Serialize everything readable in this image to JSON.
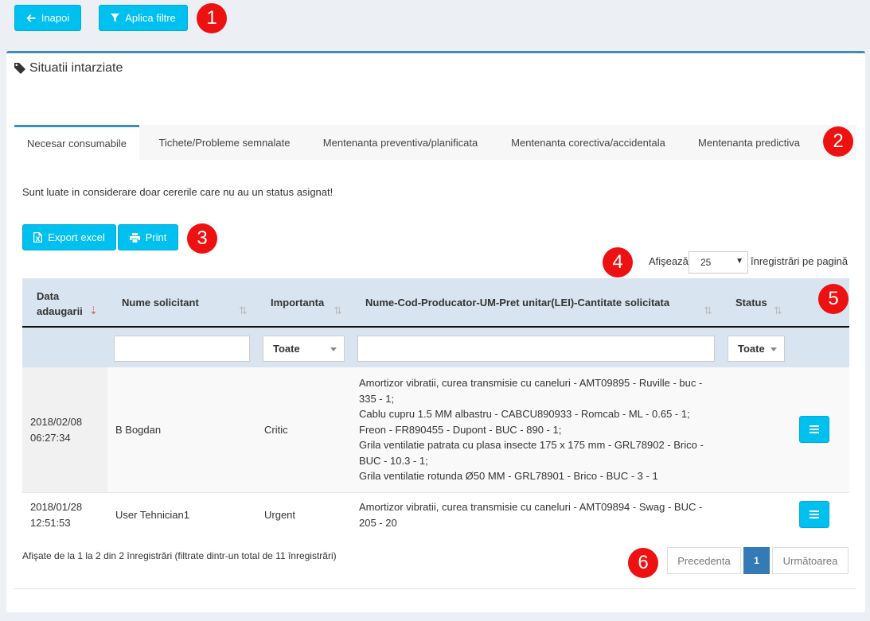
{
  "toolbar": {
    "back_label": "Inapoi",
    "apply_filters_label": "Aplica filtre"
  },
  "box": {
    "title": "Situatii intarziate"
  },
  "tabs": [
    {
      "label": "Necesar consumabile",
      "active": true
    },
    {
      "label": "Tichete/Probleme semnalate",
      "active": false
    },
    {
      "label": "Mentenanta preventiva/planificata",
      "active": false
    },
    {
      "label": "Mentenanta corectiva/accidentala",
      "active": false
    },
    {
      "label": "Mentenanta predictiva",
      "active": false
    }
  ],
  "note": "Sunt luate in considerare doar cererile care nu au un status asignat!",
  "actions": {
    "export_label": "Export excel",
    "print_label": "Print"
  },
  "length": {
    "prefix": "Afişează",
    "value": "25",
    "suffix": "înregistrări pe pagină"
  },
  "table": {
    "columns": {
      "date_line1": "Data",
      "date_line2": "adaugarii",
      "requester": "Nume solicitant",
      "importance": "Importanta",
      "items": "Nume-Cod-Producator-UM-Pret unitar(LEI)-Cantitate solicitata",
      "status": "Status"
    },
    "filters": {
      "importance_value": "Toate",
      "status_value": "Toate"
    },
    "rows": [
      {
        "date": "2018/02/08",
        "time": "06:27:34",
        "requester": "B Bogdan",
        "importance": "Critic",
        "lines": [
          "Amortizor vibratii, curea transmisie cu caneluri - AMT09895 - Ruville - buc -",
          "335 - 1;",
          "Cablu cupru 1.5 MM albastru - CABCU890933 - Romcab - ML - 0.65 - 1;",
          "Freon - FR890455 - Dupont - BUC - 890 - 1;",
          "Grila ventilatie patrata cu plasa insecte 175 x 175 mm - GRL78902 - Brico -",
          "BUC - 10.3 - 1;",
          "Grila ventilatie rotunda Ø50 MM - GRL78901 - Brico - BUC - 3 - 1"
        ]
      },
      {
        "date": "2018/01/28",
        "time": "12:51:53",
        "requester": "User Tehnician1",
        "importance": "Urgent",
        "lines": [
          "Amortizor vibratii, curea transmisie cu caneluri - AMT09894 - Swag - BUC -",
          "205 - 20"
        ]
      }
    ]
  },
  "info": "Afişate de la 1 la 2 din 2 înregistrări (filtrate dintr-un total de 11 înregistrări)",
  "pagination": {
    "previous_label": "Precedenta",
    "current_page": "1",
    "next_label": "Următoarea"
  },
  "markers": [
    "1",
    "2",
    "3",
    "4",
    "5",
    "6"
  ],
  "colors": {
    "accent": "#00c0ef",
    "primary": "#3c8dbc",
    "page_active": "#337ab7",
    "marker": "#ee1111",
    "header_bg": "#d8e5f0"
  }
}
